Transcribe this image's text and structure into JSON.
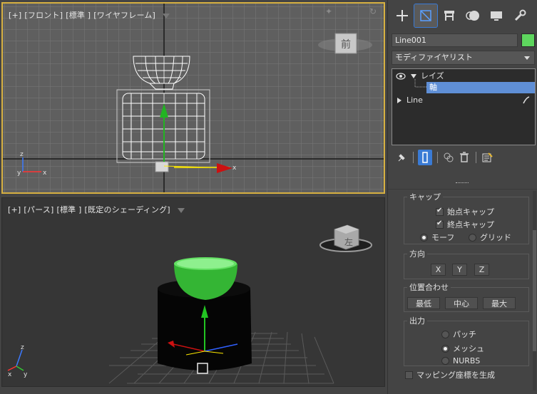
{
  "viewports": {
    "front": {
      "label_parts": [
        "[+]",
        "[フロント]",
        "[標準 ]",
        "[ワイヤフレーム]"
      ],
      "viewcube_label": "前",
      "axes": {
        "z": "z",
        "y": "y",
        "x": "x"
      }
    },
    "persp": {
      "label_parts": [
        "[+]",
        "[パース]",
        "[標準 ]",
        "[既定のシェーディング]"
      ],
      "viewcube_label": "左",
      "axes": {
        "z": "z",
        "y": "y",
        "x": "x"
      }
    }
  },
  "panel": {
    "tabs": [
      "create-tab",
      "modify-tab",
      "hierarchy-tab",
      "motion-tab",
      "display-tab",
      "utilities-tab"
    ],
    "object_name": "Line001",
    "object_color": "#5ed65e",
    "modifier_list_label": "モディファイヤリスト",
    "stack": [
      {
        "label": "レイズ"
      },
      {
        "label": "軸"
      },
      {
        "label": "Line"
      }
    ],
    "snap_group": {
      "title": "キャップ",
      "start_cap": "始点キャップ",
      "end_cap": "終点キャップ",
      "morph": "モーフ",
      "grid": "グリッド"
    },
    "direction_group": {
      "title": "方向",
      "x": "X",
      "y": "Y",
      "z": "Z"
    },
    "align_group": {
      "title": "位置合わせ",
      "min": "最低",
      "center": "中心",
      "max": "最大"
    },
    "output_group": {
      "title": "出力",
      "patch": "パッチ",
      "mesh": "メッシュ",
      "nurbs": "NURBS"
    },
    "mapping_label": "マッピング座標を生成"
  }
}
